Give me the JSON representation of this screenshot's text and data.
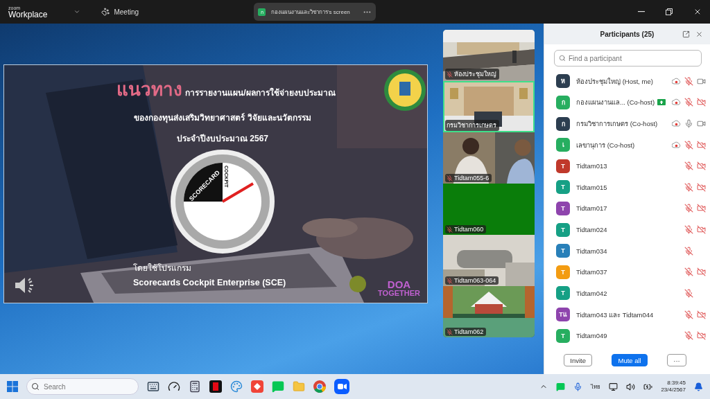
{
  "title_bar": {
    "brand_small": "zoom",
    "brand": "Workplace",
    "meeting": "Meeting",
    "share_pill": {
      "initial": "ก",
      "label": "กองแผนงานและวิชาการ's screen"
    }
  },
  "slide": {
    "heading_emphasis": "แนวทาง",
    "heading_rest": "การรายงานแผน/ผลการใช้จ่ายงบประมาณ",
    "line_2": "ของกองทุนส่งเสริมวิทยาศาสตร์ วิจัยและนวัตกรรม",
    "line_3": "ประจำปีงบประมาณ 2567",
    "gauge_top": "SCORECARD",
    "gauge_side": "COCKPIT",
    "caption": "โดยใช้โปรแกรม",
    "program": "Scorecards Cockpit Enterprise (SCE)",
    "logo_text": "DOA",
    "logo_subtext": "TOGETHER"
  },
  "videos": [
    {
      "name": "ห้องประชุมใหญ่",
      "muted": true,
      "selected": false,
      "kind": "room"
    },
    {
      "name": "กรมวิชาการเกษตร",
      "muted": false,
      "selected": true,
      "kind": "office"
    },
    {
      "name": "Tidtam055-6",
      "muted": true,
      "selected": false,
      "kind": "people"
    },
    {
      "name": "Tidtam060",
      "muted": true,
      "selected": false,
      "kind": "off"
    },
    {
      "name": "Tidtam063-064",
      "muted": true,
      "selected": false,
      "kind": "blur"
    },
    {
      "name": "Tidtam062",
      "muted": true,
      "selected": false,
      "kind": "hall"
    }
  ],
  "participants_panel": {
    "title": "Participants (25)",
    "search": {
      "placeholder": "Find a participant"
    },
    "participants": [
      {
        "initial": "ห",
        "label": "ห้องประชุมใหญ่ (Host, me)",
        "color": "#2c3e50",
        "sharing": false,
        "recording": true,
        "mic_muted": true,
        "video_shown": true,
        "video_off": false
      },
      {
        "initial": "ก",
        "label": "กองแผนงานแล...  (Co-host)",
        "color": "#27ae60",
        "sharing": true,
        "recording": true,
        "mic_muted": true,
        "video_shown": true,
        "video_off": true
      },
      {
        "initial": "ก",
        "label": "กรมวิชาการเกษตร (Co-host)",
        "color": "#2c3e50",
        "sharing": false,
        "recording": true,
        "mic_muted": false,
        "video_shown": true,
        "video_off": false
      },
      {
        "initial": "เ",
        "label": "เลขานุการ (Co-host)",
        "color": "#27ae60",
        "sharing": false,
        "recording": true,
        "mic_muted": true,
        "video_shown": true,
        "video_off": true
      },
      {
        "initial": "T",
        "label": "Tidtam013",
        "color": "#c0392b",
        "sharing": false,
        "recording": false,
        "mic_muted": true,
        "video_shown": true,
        "video_off": true
      },
      {
        "initial": "T",
        "label": "Tidtam015",
        "color": "#16a085",
        "sharing": false,
        "recording": false,
        "mic_muted": true,
        "video_shown": true,
        "video_off": true
      },
      {
        "initial": "T",
        "label": "Tidtam017",
        "color": "#8e44ad",
        "sharing": false,
        "recording": false,
        "mic_muted": true,
        "video_shown": true,
        "video_off": true
      },
      {
        "initial": "T",
        "label": "Tidtam024",
        "color": "#16a085",
        "sharing": false,
        "recording": false,
        "mic_muted": true,
        "video_shown": true,
        "video_off": true
      },
      {
        "initial": "T",
        "label": "Tidtam034",
        "color": "#2980b9",
        "sharing": false,
        "recording": false,
        "mic_muted": true,
        "video_shown": false
      },
      {
        "initial": "T",
        "label": "Tidtam037",
        "color": "#f39c12",
        "sharing": false,
        "recording": false,
        "mic_muted": true,
        "video_shown": true,
        "video_off": true
      },
      {
        "initial": "T",
        "label": "Tidtam042",
        "color": "#16a085",
        "sharing": false,
        "recording": false,
        "mic_muted": true,
        "video_shown": false
      },
      {
        "initial": "Tแ",
        "label": "Tidtam043 และ Tidtam044",
        "color": "#8e44ad",
        "sharing": false,
        "recording": false,
        "mic_muted": true,
        "video_shown": true,
        "video_off": true
      },
      {
        "initial": "T",
        "label": "Tidtam049",
        "color": "#27ae60",
        "sharing": false,
        "recording": false,
        "mic_muted": true,
        "video_shown": true,
        "video_off": true
      }
    ],
    "buttons": {
      "invite": "Invite",
      "mute_all": "Mute all",
      "more": "···"
    }
  },
  "taskbar": {
    "search": {
      "placeholder": "Search"
    },
    "language": "ไทย",
    "time": "8:39:45",
    "date": "23/4/2567"
  }
}
